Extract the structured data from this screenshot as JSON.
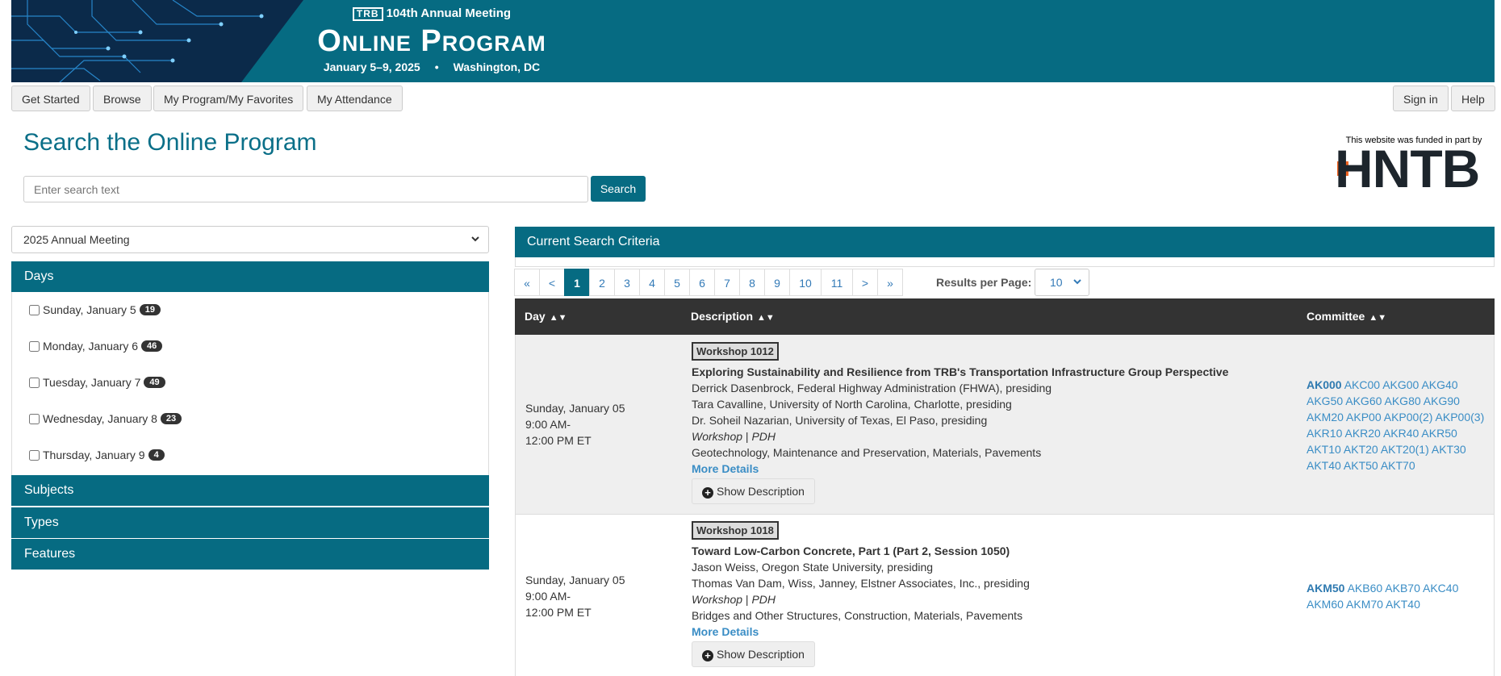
{
  "banner": {
    "org_logo": "TRB",
    "line1": "104th Annual Meeting",
    "title": "Online Program",
    "dates": "January 5–9, 2025",
    "separator": "•",
    "location": "Washington, DC"
  },
  "nav": {
    "get_started": "Get Started",
    "browse": "Browse",
    "my_program": "My Program/My Favorites",
    "my_attendance": "My Attendance",
    "sign_in": "Sign in",
    "help": "Help"
  },
  "search": {
    "title": "Search the Online Program",
    "placeholder": "Enter search text",
    "button": "Search"
  },
  "sponsor": {
    "note": "This website was funded in part by",
    "logo_text": "HNTB"
  },
  "filters": {
    "meeting": "2025 Annual Meeting",
    "days_label": "Days",
    "days": [
      {
        "label": "Sunday, January 5",
        "count": "19"
      },
      {
        "label": "Monday, January 6",
        "count": "46"
      },
      {
        "label": "Tuesday, January 7",
        "count": "49"
      },
      {
        "label": "Wednesday, January 8",
        "count": "23"
      },
      {
        "label": "Thursday, January 9",
        "count": "4"
      }
    ],
    "subjects_label": "Subjects",
    "types_label": "Types",
    "features_label": "Features"
  },
  "criteria": {
    "title": "Current Search Criteria"
  },
  "pager": {
    "first": "«",
    "prev": "<",
    "pages": [
      "1",
      "2",
      "3",
      "4",
      "5",
      "6",
      "7",
      "8",
      "9",
      "10",
      "11"
    ],
    "active": "1",
    "next": ">",
    "last": "»",
    "rpp_label": "Results per Page:",
    "rpp_value": "10"
  },
  "table": {
    "headers": {
      "day": "Day",
      "description": "Description",
      "committee": "Committee"
    },
    "rows": [
      {
        "day": "Sunday, January 05",
        "time_start": "9:00 AM-",
        "time_end": "12:00 PM ET",
        "session": "Workshop 1012",
        "title": "Exploring Sustainability and Resilience from TRB's Transportation Infrastructure Group Perspective",
        "people": [
          "Derrick Dasenbrock, Federal Highway Administration (FHWA), presiding",
          "Tara Cavalline, University of North Carolina, Charlotte, presiding",
          "Dr. Soheil Nazarian, University of Texas, El Paso, presiding"
        ],
        "type": "Workshop",
        "type_sep": "|",
        "credit": "PDH",
        "subjects": "Geotechnology, Maintenance and Preservation, Materials, Pavements",
        "more": "More Details",
        "show": "Show Description",
        "committee_lead": "AK000",
        "committee_lines": [
          "AKC00 AKG00 AKG40",
          "AKG50 AKG60 AKG80 AKG90",
          "AKM20 AKP00 AKP00(2) AKP00(3)",
          "AKR10 AKR20 AKR40 AKR50",
          "AKT10 AKT20 AKT20(1) AKT30",
          "AKT40 AKT50 AKT70"
        ]
      },
      {
        "day": "Sunday, January 05",
        "time_start": "9:00 AM-",
        "time_end": "12:00 PM ET",
        "session": "Workshop 1018",
        "title": "Toward Low-Carbon Concrete, Part 1 (Part 2, Session 1050)",
        "people": [
          "Jason Weiss, Oregon State University, presiding",
          "Thomas Van Dam, Wiss, Janney, Elstner Associates, Inc., presiding"
        ],
        "type": "Workshop",
        "type_sep": "|",
        "credit": "PDH",
        "subjects": "Bridges and Other Structures, Construction, Materials, Pavements",
        "more": "More Details",
        "show": "Show Description",
        "committee_lead": "AKM50",
        "committee_lines": [
          "AKB60 AKB70 AKC40",
          "AKM60 AKM70 AKT40"
        ]
      }
    ]
  },
  "colors": {
    "brand_teal": "#066b82",
    "table_header": "#333333",
    "link_blue": "#3a8dc5",
    "sponsor_orange": "#f26522"
  }
}
